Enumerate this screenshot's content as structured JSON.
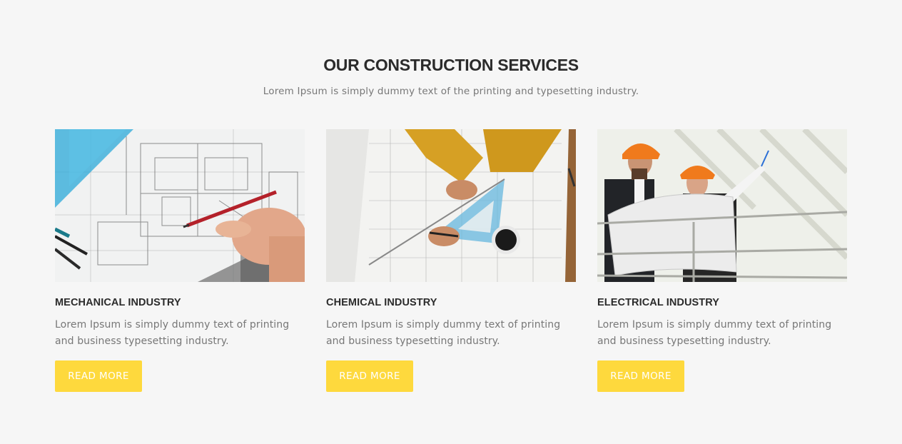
{
  "header": {
    "title": "OUR CONSTRUCTION SERVICES",
    "subtitle": "Lorem Ipsum is simply dummy text of the printing and typesetting industry."
  },
  "services": [
    {
      "title": "MECHANICAL INDUSTRY",
      "text": "Lorem Ipsum is simply dummy text of printing and business typesetting industry.",
      "button_label": "READ MORE",
      "image": "blueprint-hand-pencil-photo"
    },
    {
      "title": "CHEMICAL INDUSTRY",
      "text": "Lorem Ipsum is simply dummy text of printing and business typesetting industry.",
      "button_label": "READ MORE",
      "image": "architect-drawing-desk-photo"
    },
    {
      "title": "ELECTRICAL INDUSTRY",
      "text": "Lorem Ipsum is simply dummy text of printing and business typesetting industry.",
      "button_label": "READ MORE",
      "image": "engineers-hardhats-photo"
    }
  ],
  "colors": {
    "background": "#f6f6f6",
    "accent": "#fed93d",
    "heading": "#2b2b2b",
    "body_text": "#777777"
  }
}
